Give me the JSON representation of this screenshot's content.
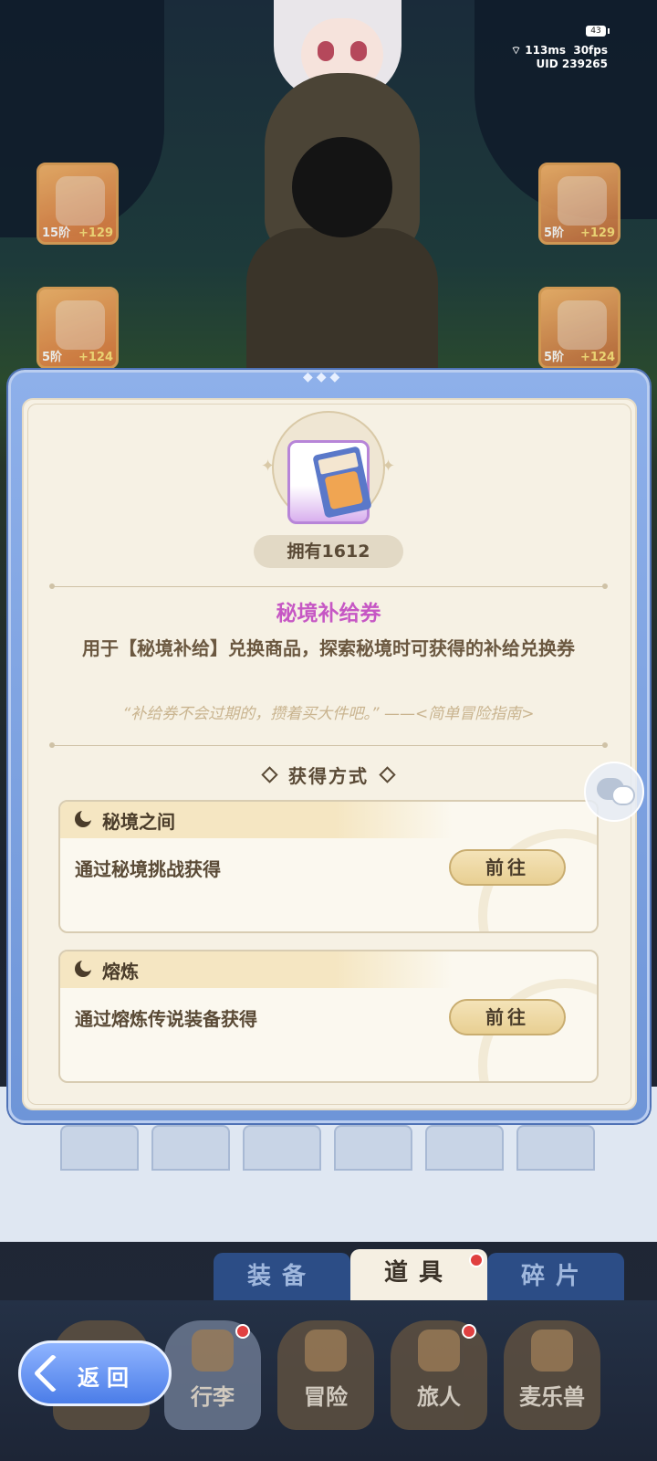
{
  "status_bar": {
    "battery": "43",
    "network": "113ms",
    "fps": "30fps",
    "uid": "UID 239265"
  },
  "equipment": [
    {
      "level": "15阶",
      "bonus": "+129"
    },
    {
      "level": "5阶",
      "bonus": "+129"
    },
    {
      "level": "5阶",
      "bonus": "+124"
    },
    {
      "level": "5阶",
      "bonus": "+124"
    }
  ],
  "item_popup": {
    "owned_count": "拥有1612",
    "name": "秘境补给券",
    "description": "用于【秘境补给】兑换商品，探索秘境时可获得的补给兑换券",
    "quote": "“补给券不会过期的，攒着买大件吧。” ——<简单冒险指南>",
    "acquire_title": "获得方式",
    "sources": [
      {
        "name": "秘境之间",
        "description": "通过秘境挑战获得",
        "button": "前往"
      },
      {
        "name": "熔炼",
        "description": "通过熔炼传说装备获得",
        "button": "前往"
      }
    ]
  },
  "inventory_tabs": {
    "equipment": "装备",
    "items": "道具",
    "fragments": "碎片"
  },
  "bottom_nav": [
    {
      "label": "行李"
    },
    {
      "label": "冒险"
    },
    {
      "label": "旅人"
    },
    {
      "label": "麦乐兽"
    }
  ],
  "back_button": {
    "label": "返回"
  },
  "colors": {
    "item_name": "#c657c4",
    "modal_frame": "#7ea2e2",
    "card_bg": "#f6f1e4"
  }
}
